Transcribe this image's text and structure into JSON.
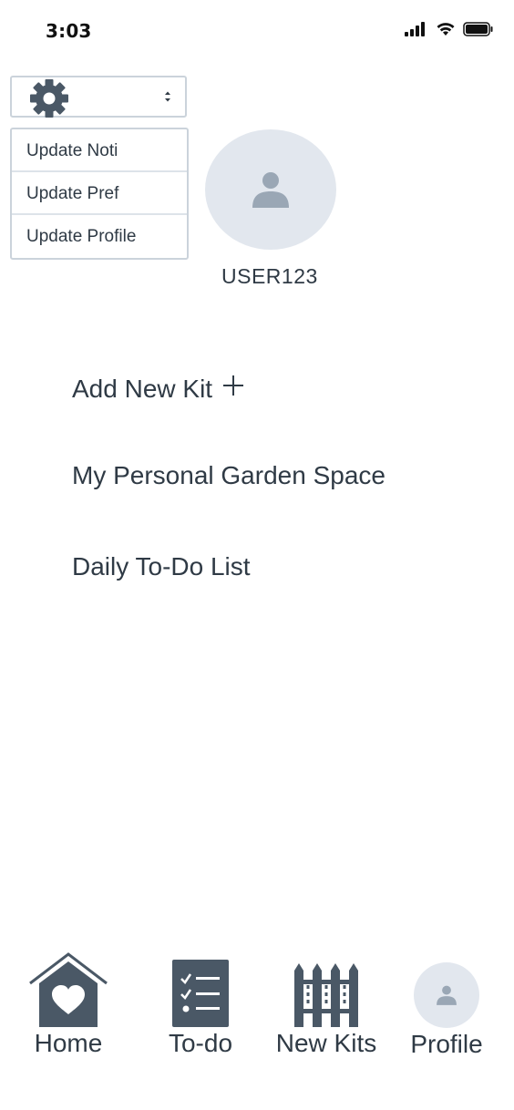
{
  "status_bar": {
    "time": "3:03"
  },
  "settings": {
    "menu_items": [
      {
        "label": "Update Noti"
      },
      {
        "label": "Update Pref"
      },
      {
        "label": "Update Profile"
      }
    ]
  },
  "profile": {
    "username": "USER123"
  },
  "main": {
    "add_new_kit": "Add New Kit",
    "garden_space": "My Personal Garden Space",
    "todo_list": "Daily To-Do List"
  },
  "bottom_nav": {
    "items": [
      {
        "label": "Home",
        "icon": "home-heart-icon"
      },
      {
        "label": "To-do",
        "icon": "checklist-icon"
      },
      {
        "label": "New Kits",
        "icon": "fence-icon"
      },
      {
        "label": "Profile",
        "icon": "avatar-icon"
      }
    ]
  },
  "colors": {
    "icon_dark": "#4a5866",
    "avatar_bg": "#e2e7ee",
    "avatar_fg": "#9aa7b5",
    "text": "#2f3a45",
    "border": "#cbd3db"
  }
}
